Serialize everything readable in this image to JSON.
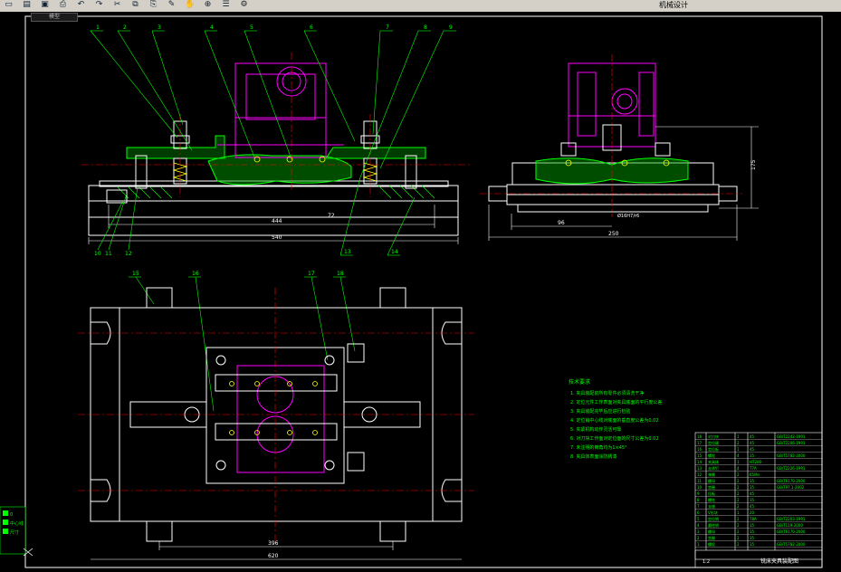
{
  "toolbar": {
    "icons": [
      "new-icon",
      "open-icon",
      "save-icon",
      "print-icon",
      "undo-icon",
      "redo-icon",
      "cut-icon",
      "copy-icon",
      "paste-icon",
      "match-icon",
      "pan-icon",
      "zoom-icon",
      "layer-icon",
      "properties-icon"
    ],
    "title": "机械设计"
  },
  "drawing_tab": "模型",
  "balloons": {
    "top": [
      "1",
      "2",
      "3",
      "4",
      "5",
      "6",
      "7",
      "8",
      "9"
    ],
    "bottom_left": [
      "10",
      "11",
      "12"
    ],
    "bottom_mid": [
      "13",
      "14"
    ],
    "plan": [
      "15",
      "16",
      "17",
      "18"
    ]
  },
  "dims": {
    "front_base": "444",
    "front_total": "540",
    "front_height": "72",
    "side_width": "96",
    "side_total": "250",
    "side_height": "175",
    "plan_inner": "396",
    "plan_total": "620",
    "tolerance": "Ø16H7/r6"
  },
  "notes": {
    "heading": "技术要求",
    "lines": [
      "1. 夹具装配前所有零件必须清洗干净",
      "2. 定位元件工作表面对夹具底面的平行度公差",
      "3. 夹具装配完毕后应进行检验",
      "4. 定位销中心线对底面的垂直度公差为0.02",
      "5. 夹紧机构动作灵活可靠",
      "6. 对刀块工作面对定位面的尺寸公差为0.02",
      "7. 未注明的倒角均为1×45°",
      "8. 夹具体表面涂防锈漆"
    ]
  },
  "title_block": {
    "rows": [
      [
        "18",
        "对刀块",
        "1",
        "45",
        "GB/T2242-1991"
      ],
      [
        "17",
        "定位键",
        "2",
        "45",
        "GB/T2206-1991"
      ],
      [
        "16",
        "定位板",
        "1",
        "45",
        ""
      ],
      [
        "15",
        "螺栓",
        "4",
        "35",
        "GB/T5782-2000"
      ],
      [
        "14",
        "夹具体",
        "1",
        "HT200",
        ""
      ],
      [
        "13",
        "支承钉",
        "4",
        "T7A",
        "GB/T2226-1991"
      ],
      [
        "12",
        "弹簧",
        "2",
        "65Mn",
        ""
      ],
      [
        "11",
        "螺母",
        "2",
        "35",
        "GB/T6170-2000"
      ],
      [
        "10",
        "垫圈",
        "2",
        "35",
        "GB/T97.1-2002"
      ],
      [
        "9",
        "压板",
        "2",
        "45",
        ""
      ],
      [
        "8",
        "螺柱",
        "2",
        "35",
        ""
      ],
      [
        "7",
        "支座",
        "2",
        "45",
        ""
      ],
      [
        "6",
        "V形块",
        "1",
        "20",
        ""
      ],
      [
        "5",
        "定位销",
        "2",
        "T8A",
        "GB/T2203-1991"
      ],
      [
        "4",
        "圆柱销",
        "2",
        "35",
        "GB/T119-2000"
      ],
      [
        "3",
        "螺母",
        "2",
        "35",
        "GB/T6170-2000"
      ],
      [
        "2",
        "垫圈",
        "2",
        "35",
        ""
      ],
      [
        "1",
        "螺栓",
        "2",
        "35",
        "GB/T5782-2000"
      ]
    ],
    "name": "铣床夹具装配图",
    "scale": "1:2"
  },
  "layers_panel": [
    "0",
    "中心线",
    "尺寸"
  ],
  "colors": {
    "outline": "#ffffff",
    "part": "#ff00ff",
    "balloon": "#00ff00",
    "center": "#ff0000",
    "section": "#00ff00",
    "yellow": "#ffff00",
    "cyan": "#00ffff"
  }
}
